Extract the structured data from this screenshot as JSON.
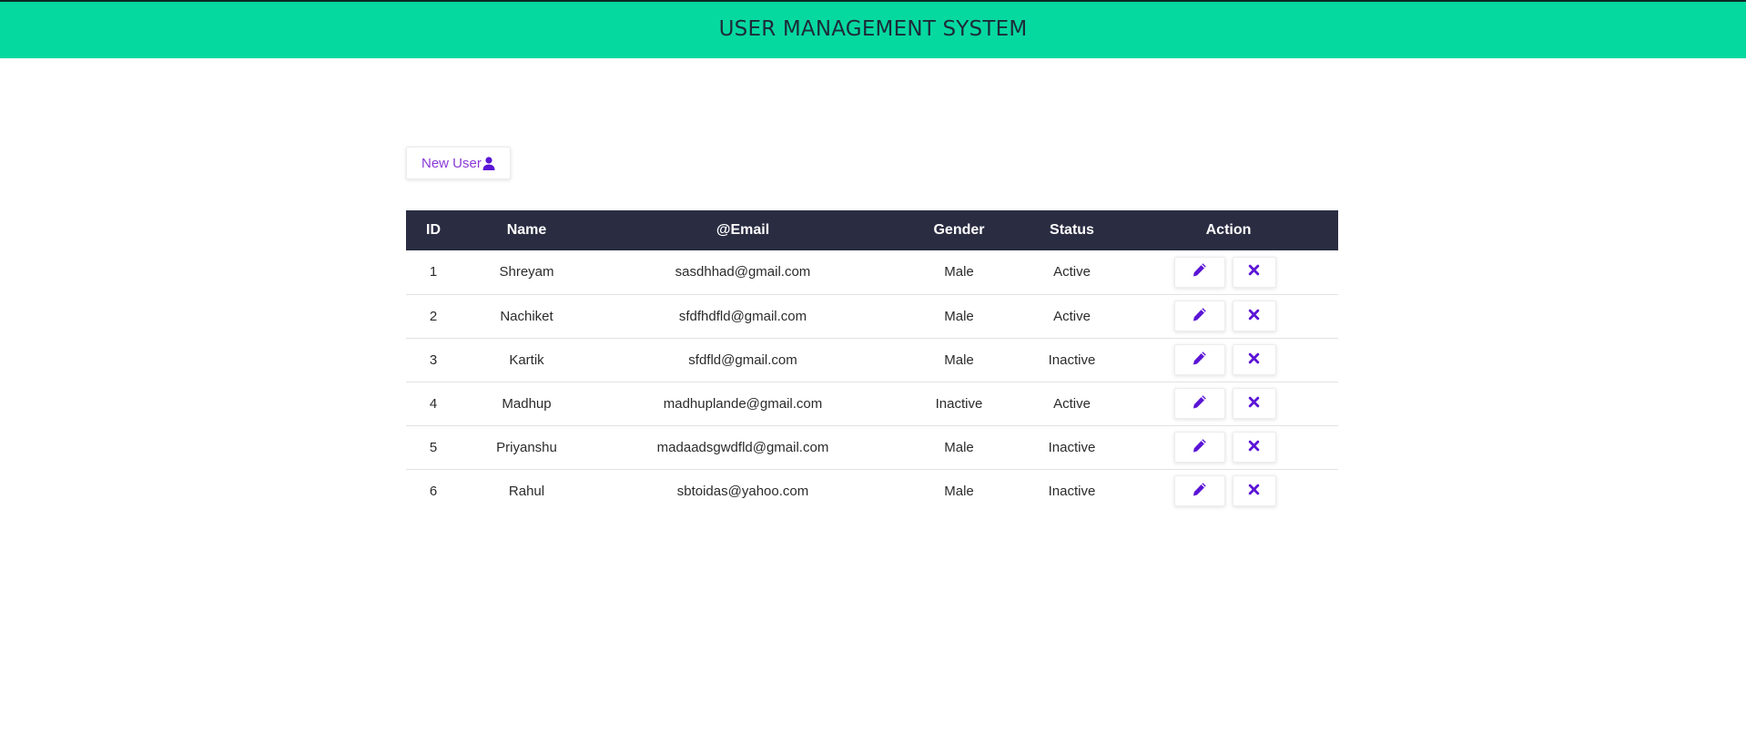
{
  "header": {
    "title": "USER MANAGEMENT SYSTEM",
    "background_color": "#06d9a0"
  },
  "toolbar": {
    "new_user_label": "New User",
    "new_user_icon": "user-icon",
    "accent_color": "#8a3ad8"
  },
  "table": {
    "header_color": "#2a2d42",
    "columns": [
      "ID",
      "Name",
      "@Email",
      "Gender",
      "Status",
      "Action"
    ],
    "rows": [
      {
        "id": "1",
        "name": "Shreyam",
        "email": "sasdhhad@gmail.com",
        "gender": "Male",
        "status": "Active"
      },
      {
        "id": "2",
        "name": "Nachiket",
        "email": "sfdfhdfld@gmail.com",
        "gender": "Male",
        "status": "Active"
      },
      {
        "id": "3",
        "name": "Kartik",
        "email": "sfdfld@gmail.com",
        "gender": "Male",
        "status": "Inactive"
      },
      {
        "id": "4",
        "name": "Madhup",
        "email": "madhuplande@gmail.com",
        "gender": "Inactive",
        "status": "Active"
      },
      {
        "id": "5",
        "name": "Priyanshu",
        "email": "madaadsgwdfld@gmail.com",
        "gender": "Male",
        "status": "Inactive"
      },
      {
        "id": "6",
        "name": "Rahul",
        "email": "sbtoidas@yahoo.com",
        "gender": "Male",
        "status": "Inactive"
      }
    ],
    "action_icons": [
      "pencil-icon",
      "close-icon"
    ]
  }
}
